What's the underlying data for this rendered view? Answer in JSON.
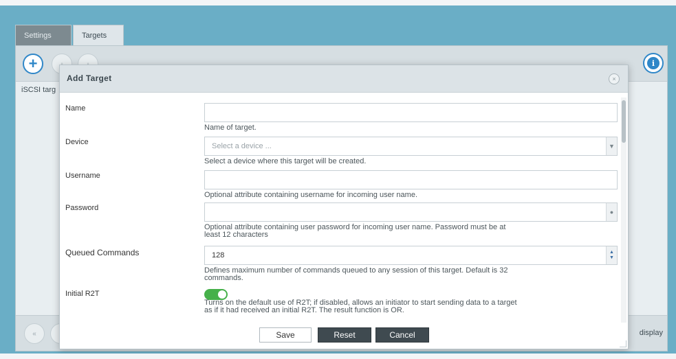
{
  "tabs": [
    {
      "label": "Settings"
    },
    {
      "label": "Targets"
    }
  ],
  "toolbar": {
    "add_icon": "plus-icon",
    "info_icon": "info-icon",
    "info_symbol": "i"
  },
  "list": {
    "label": "iSCSI targ"
  },
  "footer": {
    "display_text": "display"
  },
  "modal": {
    "title": "Add Target",
    "close_symbol": "×",
    "fields": {
      "name": {
        "label": "Name",
        "value": "",
        "hint": "Name of target."
      },
      "device": {
        "label": "Device",
        "placeholder": "Select a device ...",
        "hint": "Select a device where this target will be created."
      },
      "username": {
        "label": "Username",
        "value": "",
        "hint": "Optional attribute containing username for incoming user name."
      },
      "password": {
        "label": "Password",
        "value": "",
        "hint_line1": "Optional attribute containing user password for incoming user name. Password must be at",
        "hint_line2": "least 12 characters"
      },
      "queued_commands": {
        "label": "Queued Commands",
        "value": "128",
        "hint_line1": "Defines maximum number of commands queued to any session of this target. Default is 32",
        "hint_line2": "commands."
      },
      "initial_r2t": {
        "label": "Initial R2T",
        "enabled": true,
        "hint_line1": "Turns on the default use of R2T; if disabled, allows an initiator to start sending data to a target",
        "hint_line2": "as if it had received an initial R2T. The result function is OR."
      }
    },
    "buttons": {
      "save": "Save",
      "reset": "Reset",
      "cancel": "Cancel"
    }
  },
  "colors": {
    "accent": "#2f87c8",
    "toggle_on": "#46b04a",
    "dark_button": "#3f4a50",
    "background": "#6aaec6"
  }
}
